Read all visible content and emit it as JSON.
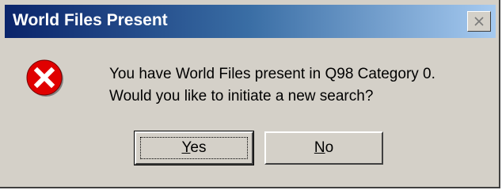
{
  "dialog": {
    "title": "World Files Present",
    "close_icon": "close-icon",
    "error_icon": "error-icon",
    "message_line1": "You have World Files present in Q98 Category 0.",
    "message_line2": "Would you like to initiate a new search?",
    "buttons": {
      "yes_mnemonic": "Y",
      "yes_rest": "es",
      "no_mnemonic": "N",
      "no_rest": "o"
    }
  },
  "colors": {
    "dialog_face": "#d4d0c8",
    "titlebar_start": "#0a246a",
    "titlebar_end": "#a6caf0",
    "error_red": "#e00000"
  }
}
